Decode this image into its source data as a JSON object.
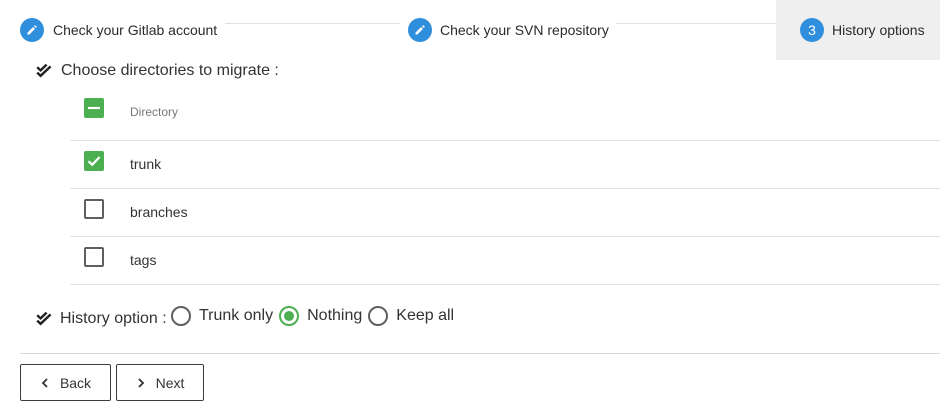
{
  "stepper": {
    "steps": [
      {
        "label": "Check your Gitlab account",
        "icon": "pencil-icon",
        "state": "done"
      },
      {
        "label": "Check your SVN repository",
        "icon": "pencil-icon",
        "state": "done"
      },
      {
        "label": "History options",
        "number": "3",
        "state": "active"
      }
    ],
    "accent_color": "#2f8fdc"
  },
  "directories": {
    "title": "Choose directories to migrate :",
    "column_header": "Directory",
    "header_checkbox_state": "indeterminate",
    "rows": [
      {
        "name": "trunk",
        "checked": true
      },
      {
        "name": "branches",
        "checked": false
      },
      {
        "name": "tags",
        "checked": false
      }
    ],
    "check_color": "#4caf50"
  },
  "history": {
    "label": "History option :",
    "options": [
      {
        "label": "Trunk only",
        "selected": false
      },
      {
        "label": "Nothing",
        "selected": true
      },
      {
        "label": "Keep all",
        "selected": false
      }
    ]
  },
  "footer": {
    "back_label": "Back",
    "next_label": "Next"
  }
}
